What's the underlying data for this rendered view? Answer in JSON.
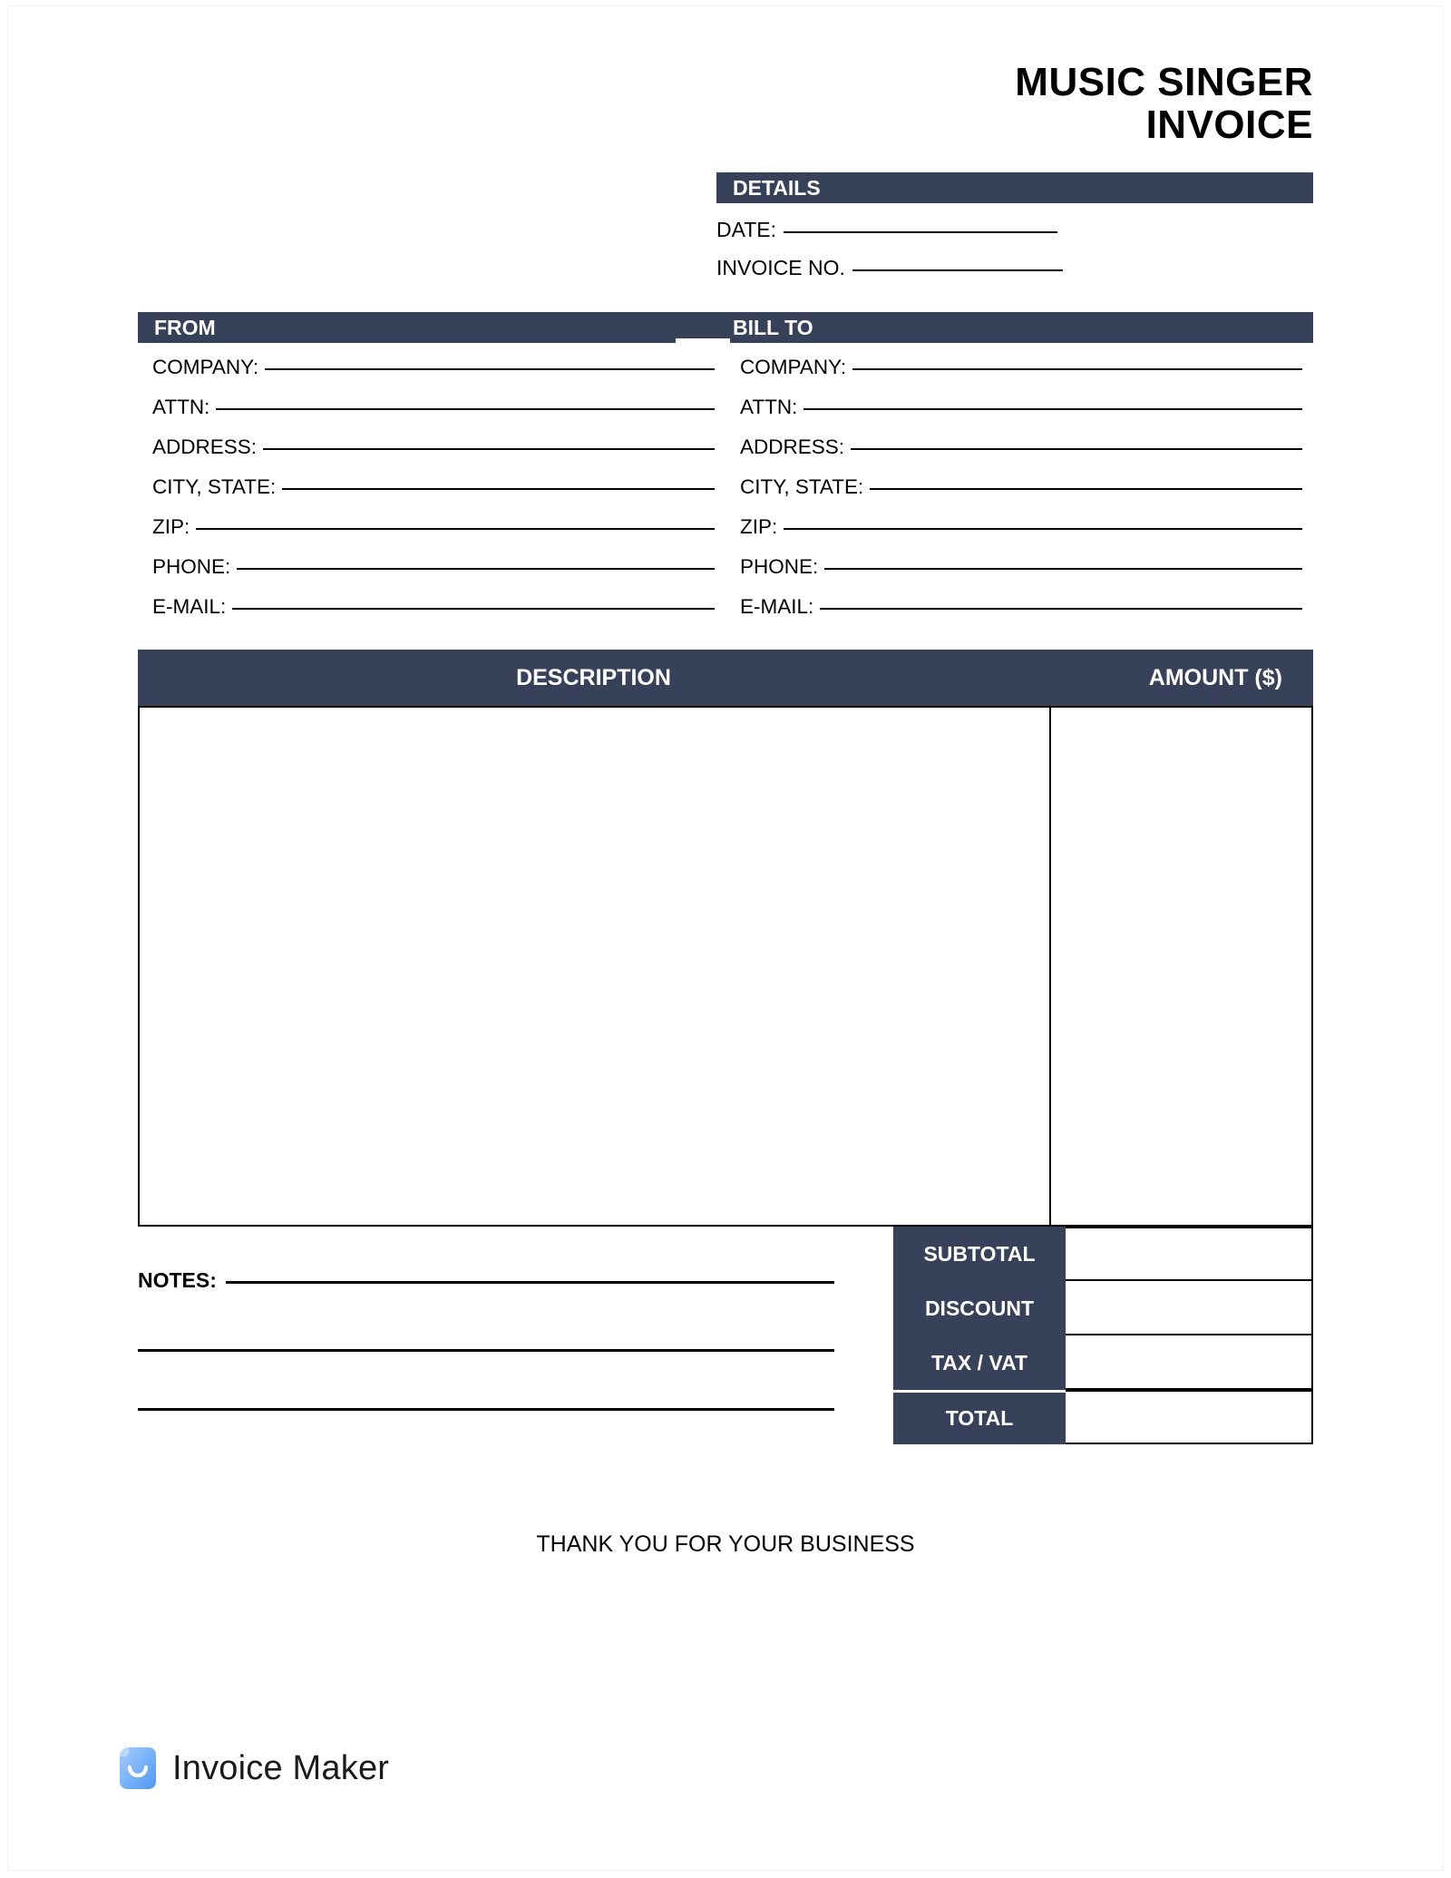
{
  "document": {
    "title_line1": "MUSIC SINGER",
    "title_line2": "INVOICE"
  },
  "details": {
    "header": "DETAILS",
    "date_label": "DATE:",
    "invoice_no_label": "INVOICE NO."
  },
  "from": {
    "header": "FROM",
    "fields": [
      {
        "label": "COMPANY:"
      },
      {
        "label": "ATTN:"
      },
      {
        "label": "ADDRESS:"
      },
      {
        "label": "CITY, STATE:"
      },
      {
        "label": "ZIP:"
      },
      {
        "label": "PHONE:"
      },
      {
        "label": "E-MAIL:"
      }
    ]
  },
  "bill_to": {
    "header": "BILL TO",
    "fields": [
      {
        "label": "COMPANY:"
      },
      {
        "label": "ATTN:"
      },
      {
        "label": "ADDRESS:"
      },
      {
        "label": "CITY, STATE:"
      },
      {
        "label": "ZIP:"
      },
      {
        "label": "PHONE:"
      },
      {
        "label": "E-MAIL:"
      }
    ]
  },
  "items_table": {
    "columns": [
      "DESCRIPTION",
      "AMOUNT ($)"
    ],
    "rows": []
  },
  "totals": {
    "rows": [
      {
        "label": "SUBTOTAL",
        "value": ""
      },
      {
        "label": "DISCOUNT",
        "value": ""
      },
      {
        "label": "TAX / VAT",
        "value": ""
      },
      {
        "label": "TOTAL",
        "value": ""
      }
    ]
  },
  "notes": {
    "label": "NOTES:",
    "value": ""
  },
  "footer": {
    "thank_you": "THANK YOU FOR YOUR BUSINESS",
    "brand": "Invoice Maker"
  },
  "colors": {
    "accent": "#38415a",
    "text": "#000000",
    "logo_blue": "#63a4f7"
  }
}
